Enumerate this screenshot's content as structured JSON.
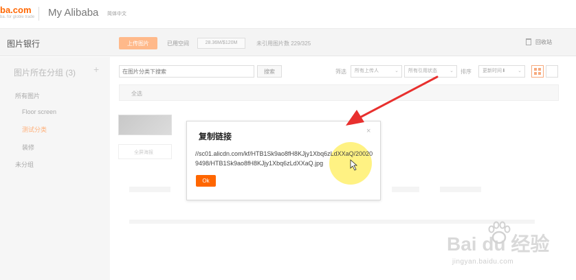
{
  "header": {
    "logo_text": "ba.com",
    "logo_sub": "ba. for globle trade",
    "app_title": "My Alibaba",
    "language": "简体中文"
  },
  "toolbar": {
    "page_title": "图片银行",
    "upload_label": "上传图片",
    "used_label": "已用空间",
    "used_value": "28.36M/$120M",
    "unref_label": "未引用图片数 229/325",
    "recycle_label": "回收站"
  },
  "sidebar": {
    "heading": "图片所在分组 (3)",
    "add_symbol": "+",
    "items": [
      {
        "label": "所有图片"
      },
      {
        "label": "Floor screen"
      },
      {
        "label": "测试分类"
      },
      {
        "label": "装修"
      },
      {
        "label": "未分组"
      }
    ]
  },
  "filters": {
    "search_placeholder": "在图片分类下搜索",
    "search_button": "搜索",
    "filter_label": "筛选",
    "uploader": "所有上传人",
    "ref_status": "所有引用状态",
    "sort_label": "排序",
    "sort_value": "更新时间⬇"
  },
  "content": {
    "select_all": "全选",
    "thumb_label": "全屏海报"
  },
  "modal": {
    "title": "复制链接",
    "close_symbol": "×",
    "link_text": "//sc01.alicdn.com/kf/HTB1Sk9ao8fH8KJjy1Xbq6zLdXXaQ/200209498/HTB1Sk9ao8fH8KJjy1Xbq6zLdXXaQ.jpg",
    "ok_label": "Ok"
  },
  "watermark": {
    "brand": "Bai du 经验",
    "url": "jingyan.baidu.com"
  },
  "colors": {
    "accent": "#ff6600",
    "arrow": "#e8302e",
    "highlight": "#fff04a"
  }
}
